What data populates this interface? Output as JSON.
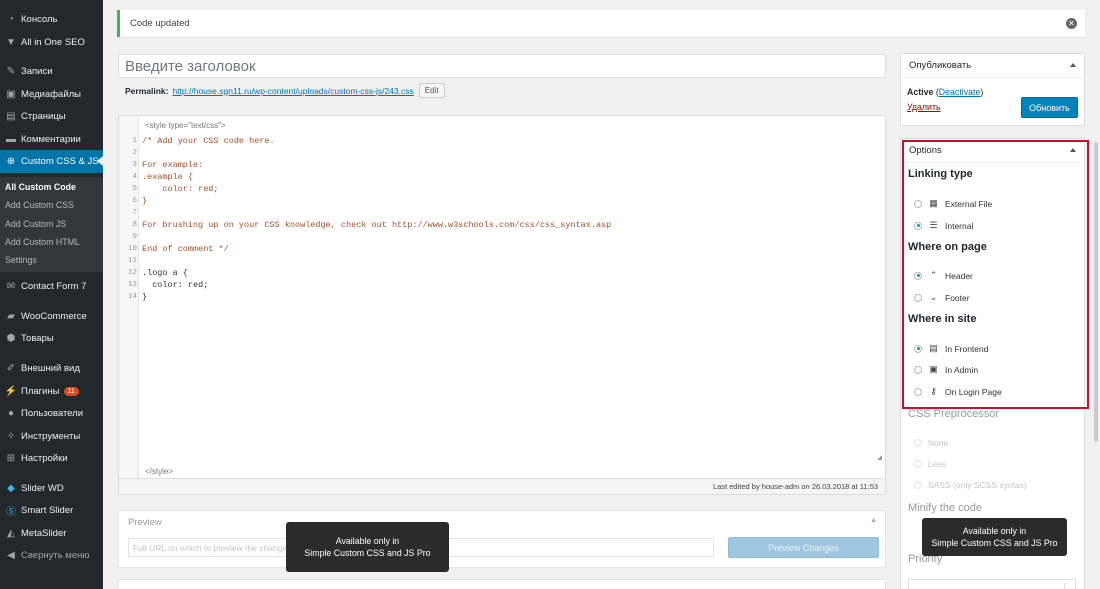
{
  "sidebar": {
    "items": [
      {
        "label": "Консоль",
        "icon": "dashboard-icon"
      },
      {
        "label": "All in One SEO",
        "icon": "shield-icon"
      },
      {
        "label": "Записи",
        "icon": "pin-icon"
      },
      {
        "label": "Медиафайлы",
        "icon": "media-icon"
      },
      {
        "label": "Страницы",
        "icon": "page-icon"
      },
      {
        "label": "Комментарии",
        "icon": "comment-icon"
      },
      {
        "label": "Custom CSS & JS",
        "icon": "plus-circle-icon"
      },
      {
        "label": "Contact Form 7",
        "icon": "mail-icon"
      },
      {
        "label": "WooCommerce",
        "icon": "woo-icon"
      },
      {
        "label": "Товары",
        "icon": "box-icon"
      },
      {
        "label": "Внешний вид",
        "icon": "brush-icon"
      },
      {
        "label": "Плагины",
        "icon": "plug-icon"
      },
      {
        "label": "Пользователи",
        "icon": "user-icon"
      },
      {
        "label": "Инструменты",
        "icon": "wrench-icon"
      },
      {
        "label": "Настройки",
        "icon": "settings-icon"
      },
      {
        "label": "Slider WD",
        "icon": "slider-icon"
      },
      {
        "label": "Smart Slider",
        "icon": "s-icon"
      },
      {
        "label": "MetaSlider",
        "icon": "meta-icon"
      },
      {
        "label": "Свернуть меню",
        "icon": "collapse-icon"
      }
    ],
    "plugins_badge": "11",
    "submenu": [
      "All Custom Code",
      "Add Custom CSS",
      "Add Custom JS",
      "Add Custom HTML",
      "Settings"
    ],
    "colors": {
      "bg": "#23282d",
      "active": "#0073aa"
    }
  },
  "notice": {
    "text": "Code updated"
  },
  "title_placeholder": "Введите заголовок",
  "permalink": {
    "label": "Permalink:",
    "url": "http://house.sgn11.ru/wp-content/uploads/custom-css-js/243.css",
    "edit": "Edit"
  },
  "editor": {
    "open_tag": "<style type=\"text/css\">",
    "close_tag": "</style>",
    "lines": [
      "/* Add your CSS code here.",
      "",
      "For example:",
      ".example {",
      "    color: red;",
      "}",
      "",
      "For brushing up on your CSS knowledge, check out http://www.w3schools.com/css/css_syntax.asp",
      "",
      "End of comment */",
      "",
      ".logo a {",
      "  color: red;",
      "}"
    ],
    "status": "Last edited by house-adm on 26.03.2018 at 11:53"
  },
  "preview": {
    "title": "Preview",
    "url_placeholder": "Full URL on which to preview the changes",
    "button": "Preview Changes"
  },
  "tooltip": {
    "line1": "Available only in",
    "line2": "Simple Custom CSS and JS Pro"
  },
  "publish": {
    "title": "Опубликовать",
    "status": "Active",
    "deactivate": "Deactivate",
    "delete": "Удалить",
    "update": "Обновить"
  },
  "options": {
    "title": "Options",
    "linking_type": "Linking type",
    "external_file": "External File",
    "internal": "Internal",
    "where_on_page": "Where on page",
    "header": "Header",
    "footer": "Footer",
    "where_in_site": "Where in site",
    "in_frontend": "In Frontend",
    "in_admin": "In Admin",
    "on_login_page": "On Login Page",
    "css_preprocessor": "CSS Preprocessor",
    "none": "None",
    "less": "Less",
    "sass": "SASS (only SCSS syntax)",
    "minify": "Minify the code",
    "priority": "Priority"
  }
}
